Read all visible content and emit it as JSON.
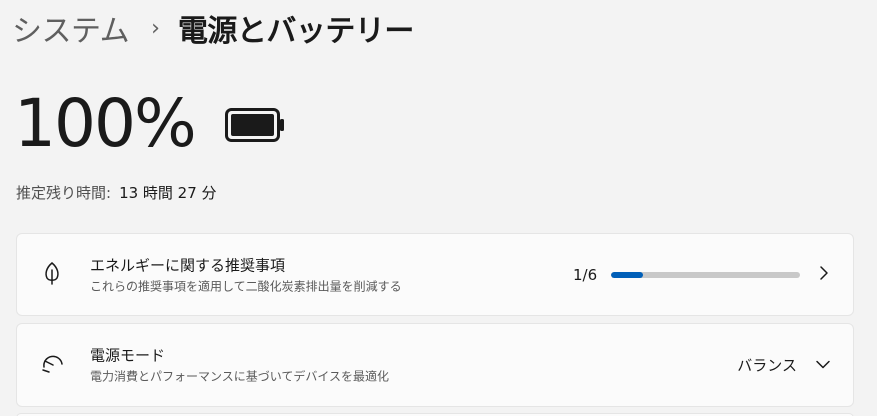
{
  "breadcrumb": {
    "parent": "システム",
    "separator": "›",
    "current": "電源とバッテリー"
  },
  "battery": {
    "percent_text": "100%",
    "level": 1.0,
    "remaining_label": "推定残り時間:",
    "remaining_value": "13 時間 27 分"
  },
  "energy_card": {
    "icon": "leaf-icon",
    "title": "エネルギーに関する推奨事項",
    "subtitle": "これらの推奨事項を適用して二酸化炭素排出量を削減する",
    "progress_text": "1/6",
    "progress_fraction": 0.1667,
    "accent_color": "#005fb8"
  },
  "power_mode_card": {
    "icon": "gauge-icon",
    "title": "電源モード",
    "subtitle": "電力消費とパフォーマンスに基づいてデバイスを最適化",
    "selected_value": "バランス"
  }
}
